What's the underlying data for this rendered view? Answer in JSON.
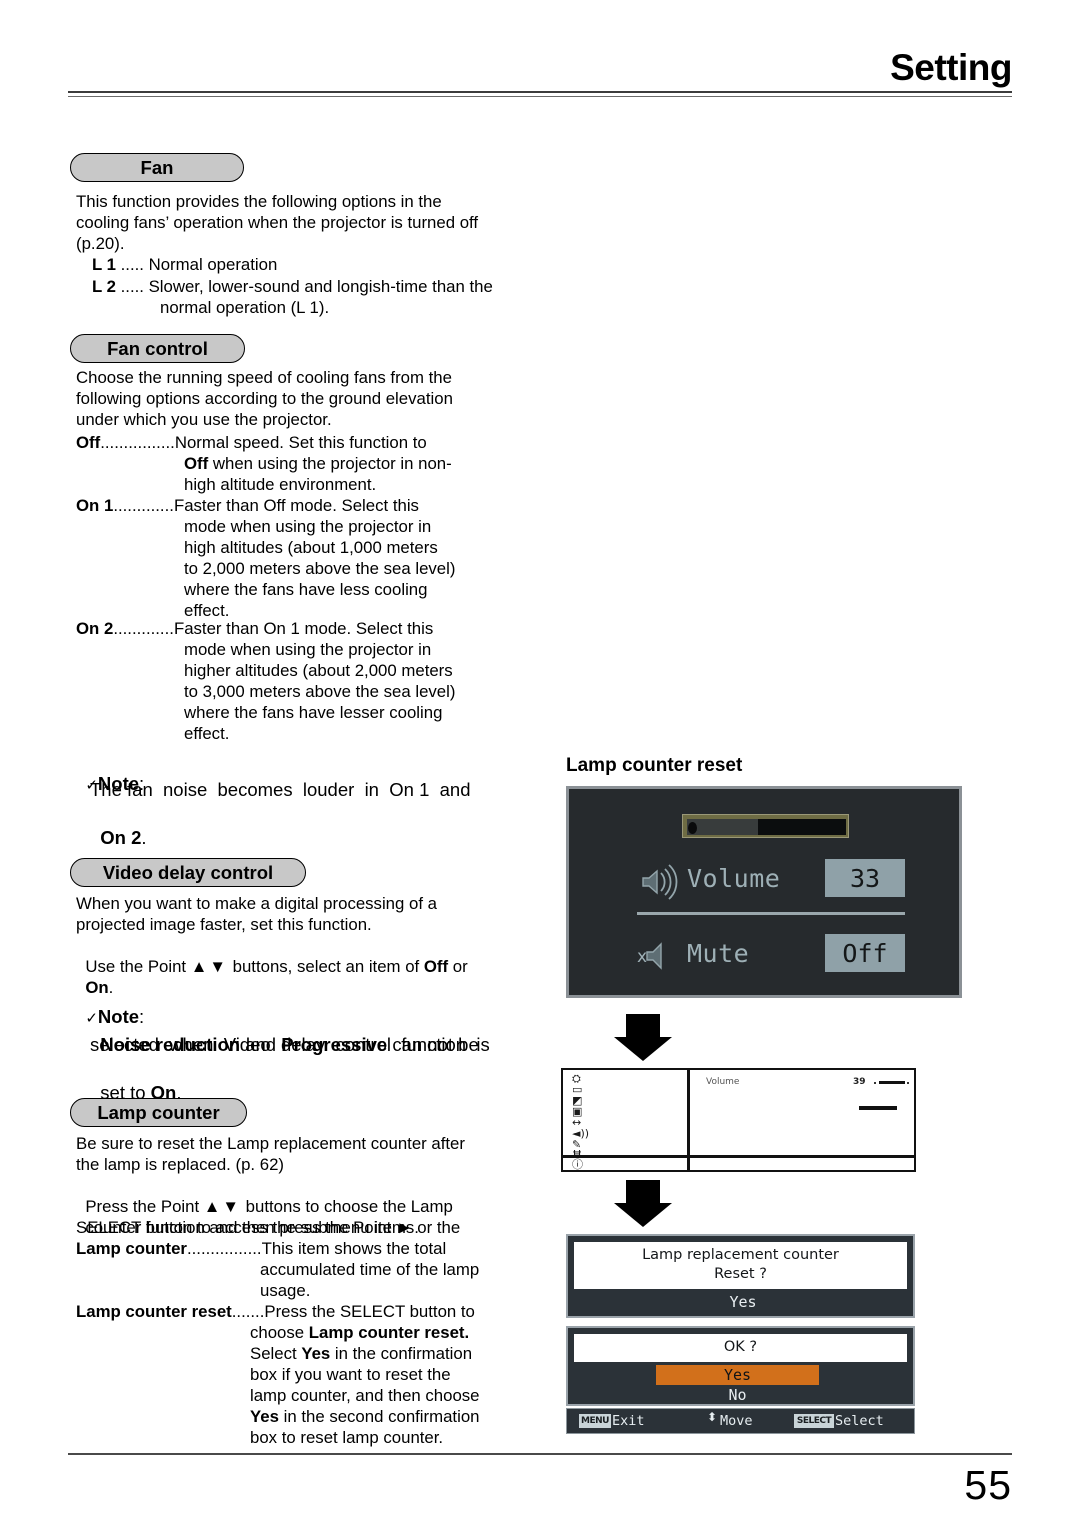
{
  "header": {
    "title": "Setting"
  },
  "sections": {
    "fan": {
      "pill": "Fan",
      "intro": "This function provides the following options in the\ncooling fans’ operation when the projector is turned off\n(p.20).",
      "items": [
        {
          "term": "L 1",
          "dots": " ..... ",
          "desc": "Normal operation"
        },
        {
          "term": "L 2",
          "dots": " ..... ",
          "desc": "Slower, lower-sound and longish-time than the"
        },
        {
          "term": "",
          "dots": "",
          "desc": "normal operation (L 1)."
        }
      ]
    },
    "fan_control": {
      "pill": "Fan control",
      "intro": "Choose the running speed of cooling fans from the\nfollowing options according to the ground elevation\nunder which you use the projector.",
      "off_term": "Off",
      "off_dots": "................",
      "off_lines": [
        "Normal speed. Set this function to",
        "Off when using the projector in non-",
        "high altitude environment."
      ],
      "on1_term": "On 1",
      "on1_dots": ".............",
      "on1_lines": [
        "Faster than Off mode. Select this",
        "mode when using the projector in",
        "high altitudes (about 1,000 meters",
        "to 2,000 meters above the sea level)",
        "where the fans have less cooling",
        "effect."
      ],
      "on2_term": "On 2",
      "on2_dots": ".............",
      "on2_lines": [
        "Faster than On 1 mode. Select this",
        "mode when using the projector in",
        "higher altitudes (about 2,000 meters",
        "to 3,000 meters above the sea level)",
        "where the fans have lesser cooling",
        "effect."
      ]
    },
    "note_fan": {
      "label": "Note",
      "colon": ":",
      "line1": "The fan  noise  becomes  louder  in  On 1  and",
      "line2_bold": "On 2",
      "line2_rest": "."
    },
    "video_delay": {
      "pill": "Video delay control",
      "line1": "When you want to make a digital processing of a",
      "line2": "projected image faster, set this function.",
      "line3_a": "Use the Point ",
      "line3_arrows": "▲▼",
      "line3_b": " buttons, select an item of ",
      "line3_off": "Off",
      "line3_c": " or",
      "line4_on": "On",
      "line4_rest": "."
    },
    "note_video": {
      "label": "Note",
      "colon": ":",
      "line1_a": "Noise reduction",
      "line1_b": " and ",
      "line1_c": "Progressive",
      "line1_d": " can not be",
      "line2": "selected  when  Video  delay  control  function  is",
      "line3_a": "set to ",
      "line3_b": "On",
      "line3_c": "."
    },
    "lamp_counter": {
      "pill": "Lamp counter",
      "p1": "Be sure to reset the Lamp replacement counter after\nthe lamp is replaced. (p. 62)",
      "p2_a": "Press the Point ",
      "p2_arrows": "▲▼",
      "p2_b": " buttons to choose the Lamp",
      "p2_c": "counter function and then press the Point ",
      "p2_right": "►",
      "p2_d": " or the",
      "p2_e": "SELECT button to access the submenu items.",
      "def1_term": "Lamp counter",
      "def1_dots": "................",
      "def1_lines": [
        "This item shows the total",
        "accumulated time of the lamp",
        "usage."
      ],
      "def2_term": "Lamp counter reset",
      "def2_dots": ".......",
      "def2_lines": [
        "Press the SELECT button to",
        "choose Lamp counter reset.",
        "Select Yes in the confirmation",
        "box if you want to reset the",
        "lamp counter, and then choose",
        "Yes in the second confirmation",
        "box to reset lamp counter."
      ]
    }
  },
  "right_column": {
    "title": "Lamp counter reset",
    "volume_osd": {
      "rows": [
        {
          "icon": "speaker-waves-icon",
          "label": "Volume",
          "value": "33"
        },
        {
          "icon": "speaker-mute-icon",
          "label": "Mute",
          "value": "Off"
        }
      ]
    },
    "menu_osd": {
      "label": "Volume",
      "value": "39",
      "icon_count": 9
    },
    "dialog1": {
      "line1": "Lamp replacement counter",
      "line2": "Reset ?",
      "options": [
        {
          "label": "Yes",
          "selected": false
        }
      ]
    },
    "dialog2": {
      "line1": "OK ?",
      "options": [
        {
          "label": "Yes",
          "selected": true
        },
        {
          "label": "No",
          "selected": false
        }
      ]
    },
    "footer_bar": {
      "exit_key": "MENU",
      "exit_label": "Exit",
      "move_label": "Move",
      "select_key": "SELECT",
      "select_label": "Select"
    }
  },
  "page_number": "55",
  "colors": {
    "pill_fill": "#c8c8c8",
    "osd_bg": "#262a2d",
    "osd_value_box": "#8fa1a8",
    "highlight_orange": "#d2701b",
    "dialog_bg": "#2b3238"
  }
}
